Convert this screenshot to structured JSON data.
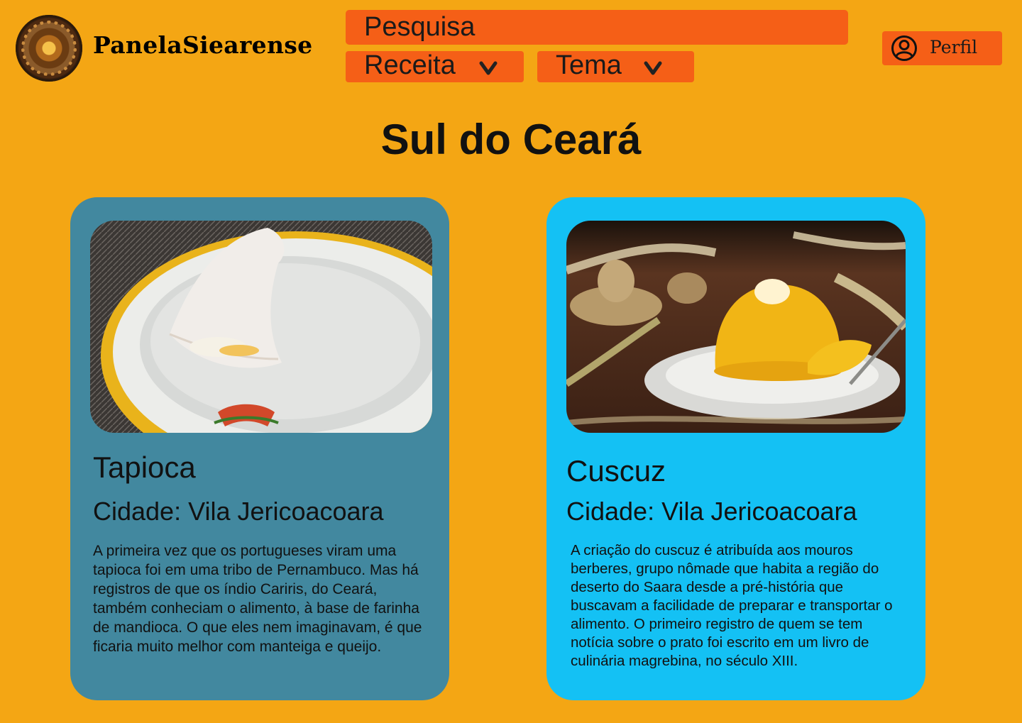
{
  "header": {
    "brand": "PanelaSiearense",
    "logo_icon": "clay-pot-logo",
    "search": {
      "placeholder": "Pesquisa",
      "icon": "search-icon"
    },
    "filters": [
      {
        "label": "Receita",
        "icon": "chevron-down-icon"
      },
      {
        "label": "Tema",
        "icon": "chevron-down-icon"
      }
    ],
    "profile": {
      "label": "Perfil",
      "icon": "user-circle-icon"
    }
  },
  "main": {
    "title": "Sul do Ceará",
    "cards": [
      {
        "name": "Tapioca",
        "city": "Cidade: Vila Jericoacoara",
        "description": "A primeira vez que os portugueses viram uma tapioca foi em uma tribo de Pernambuco. Mas há registros de que os índio Cariris, do Ceará, também conheciam o alimento, à base de farinha de mandioca. O que eles nem imaginavam, é que ficaria muito melhor com manteiga e queijo.",
        "background": "#42889F"
      },
      {
        "name": "Cuscuz",
        "city": "Cidade: Vila Jericoacoara",
        "description": "A criação do cuscuz é atribuída aos mouros berberes, grupo nômade que habita a região do deserto do Saara desde a pré-história que buscavam a facilidade de preparar e transportar o alimento. O primeiro registro de quem se tem notícia sobre o prato foi escrito em um livro de culinária magrebina, no século XIII.",
        "background": "#14C1F4"
      }
    ]
  },
  "colors": {
    "page_background": "#F4A614",
    "accent": "#F55F17"
  }
}
